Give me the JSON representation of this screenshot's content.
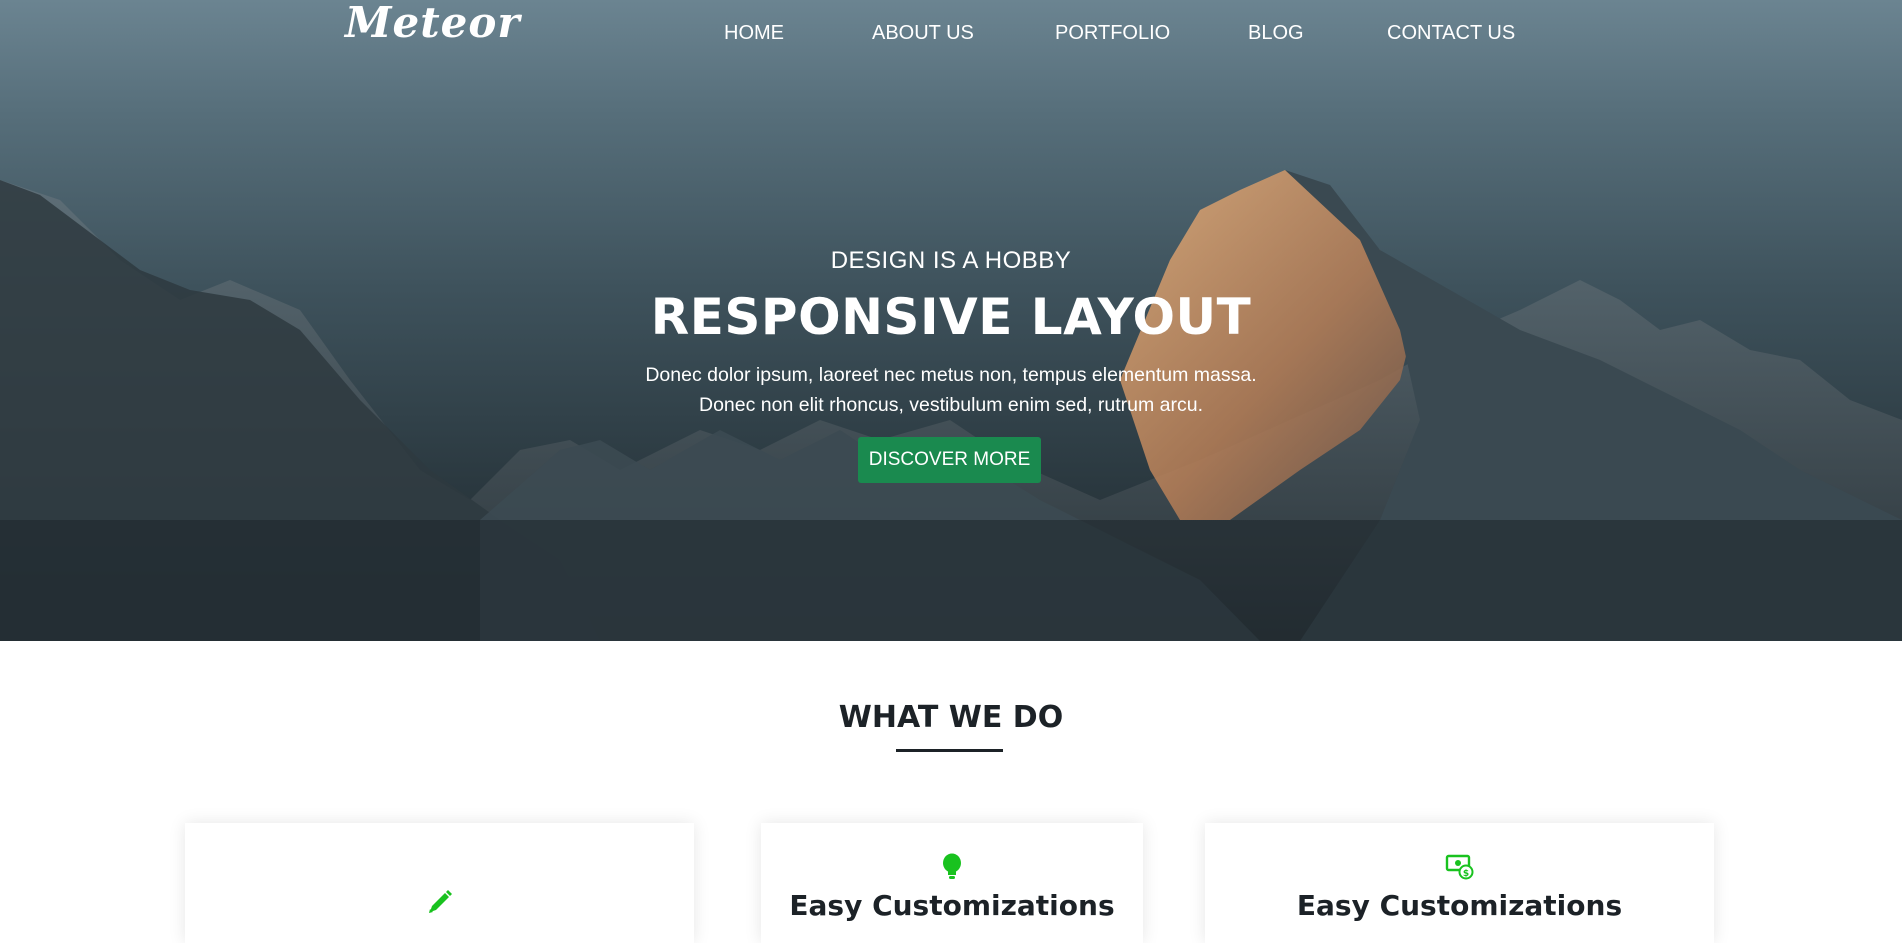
{
  "nav": {
    "logo": "Meteor",
    "items": [
      "HOME",
      "ABOUT US",
      "PORTFOLIO",
      "BLOG",
      "CONTACT US"
    ]
  },
  "hero": {
    "eyebrow": "DESIGN IS A HOBBY",
    "headline": "RESPONSIVE LAYOUT",
    "description_line1": "Donec dolor ipsum, laoreet nec metus non, tempus elementum massa.",
    "description_line2": "Donec non elit rhoncus, vestibulum enim sed, rutrum arcu.",
    "cta_label": "DISCOVER MORE"
  },
  "section": {
    "title": "WHAT WE DO"
  },
  "cards": [
    {
      "icon": "pencil-icon",
      "title": ""
    },
    {
      "icon": "lightbulb-icon",
      "title": "Easy Customizations"
    },
    {
      "icon": "money-icon",
      "title": "Easy Customizations"
    }
  ],
  "colors": {
    "accent": "#1a8a4f",
    "icon_green": "#19c21f",
    "text_dark": "#1c2227"
  }
}
